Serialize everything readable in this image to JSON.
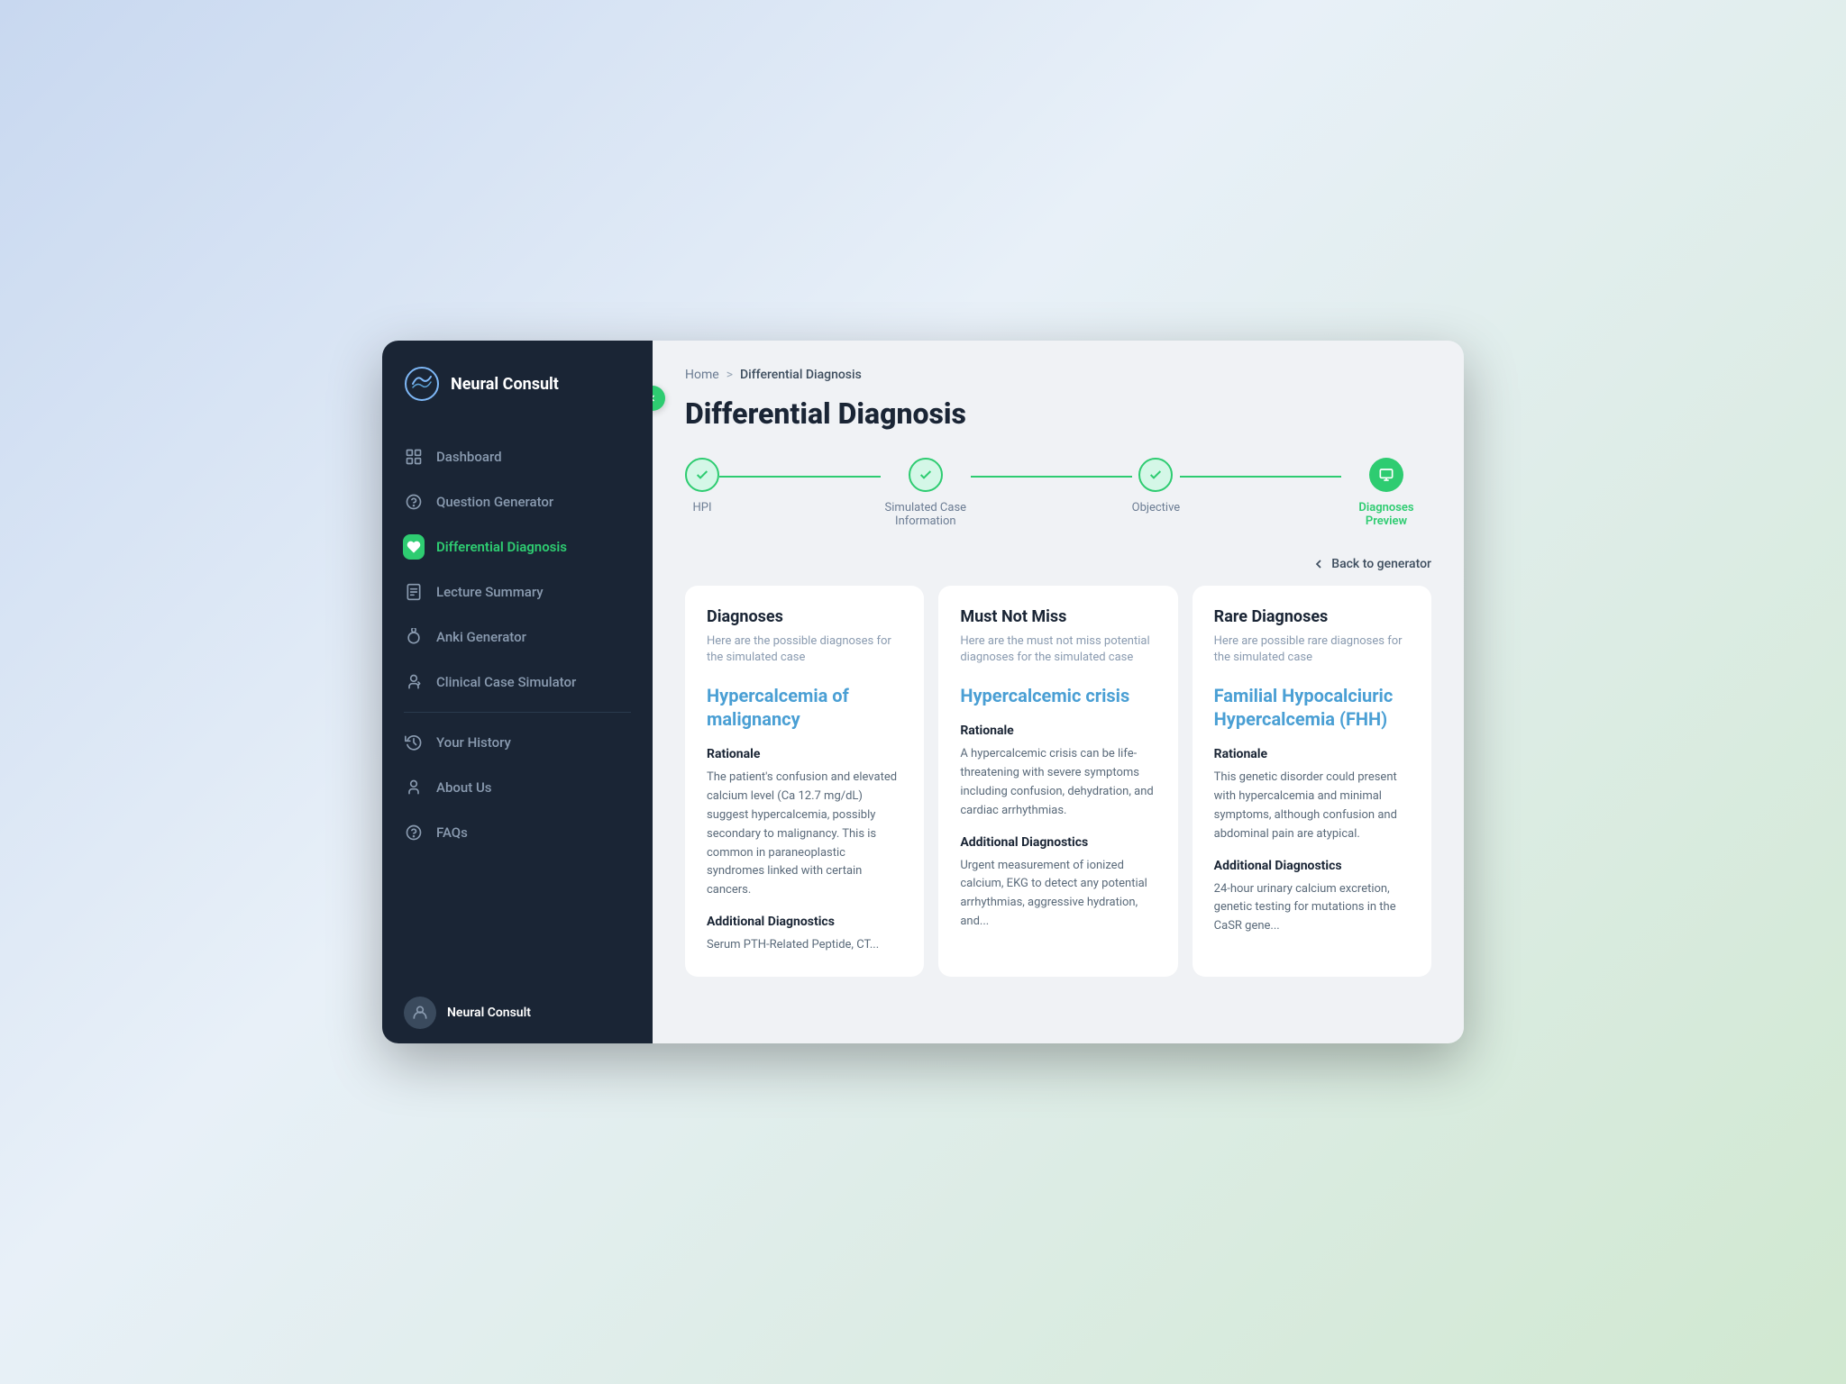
{
  "app": {
    "name": "Neural Consult",
    "logo_alt": "neural-consult-logo"
  },
  "sidebar": {
    "nav_items": [
      {
        "id": "dashboard",
        "label": "Dashboard",
        "icon": "home-icon",
        "active": false
      },
      {
        "id": "question-generator",
        "label": "Question Generator",
        "icon": "question-icon",
        "active": false
      },
      {
        "id": "differential-diagnosis",
        "label": "Differential Diagnosis",
        "icon": "heart-icon",
        "active": true
      },
      {
        "id": "lecture-summary",
        "label": "Lecture Summary",
        "icon": "document-icon",
        "active": false
      },
      {
        "id": "anki-generator",
        "label": "Anki Generator",
        "icon": "brain-icon",
        "active": false
      },
      {
        "id": "clinical-case-simulator",
        "label": "Clinical Case Simulator",
        "icon": "person-icon",
        "active": false
      }
    ],
    "bottom_items": [
      {
        "id": "your-history",
        "label": "Your History",
        "icon": "history-icon"
      },
      {
        "id": "about-us",
        "label": "About Us",
        "icon": "about-icon"
      },
      {
        "id": "faqs",
        "label": "FAQs",
        "icon": "faq-icon"
      }
    ],
    "user": {
      "name": "Neural Consult",
      "icon": "user-avatar"
    }
  },
  "breadcrumb": {
    "home": "Home",
    "separator": ">",
    "current": "Differential Diagnosis"
  },
  "page": {
    "title": "Differential Diagnosis",
    "back_link": "Back to generator"
  },
  "progress": {
    "steps": [
      {
        "id": "hpi",
        "label": "HPI",
        "state": "done"
      },
      {
        "id": "simulated-case",
        "label": "Simulated Case Information",
        "state": "done"
      },
      {
        "id": "objective",
        "label": "Objective",
        "state": "done"
      },
      {
        "id": "diagnoses-preview",
        "label": "Diagnoses Preview",
        "state": "active"
      }
    ]
  },
  "cards": [
    {
      "id": "diagnoses",
      "title": "Diagnoses",
      "subtitle": "Here are the possible diagnoses for the simulated case",
      "diagnosis_name": "Hypercalcemia of malignancy",
      "rationale_label": "Rationale",
      "rationale_text": "The patient's confusion and elevated calcium level (Ca 12.7 mg/dL) suggest hypercalcemia, possibly secondary to malignancy. This is common in paraneoplastic syndromes linked with certain cancers.",
      "additional_label": "Additional Diagnostics",
      "additional_text": "Serum PTH-Related Peptide, CT..."
    },
    {
      "id": "must-not-miss",
      "title": "Must Not Miss",
      "subtitle": "Here are the must not miss potential diagnoses for the simulated case",
      "diagnosis_name": "Hypercalcemic crisis",
      "rationale_label": "Rationale",
      "rationale_text": "A hypercalcemic crisis can be life-threatening with severe symptoms including confusion, dehydration, and cardiac arrhythmias.",
      "additional_label": "Additional Diagnostics",
      "additional_text": "Urgent measurement of ionized calcium, EKG to detect any potential arrhythmias, aggressive hydration, and..."
    },
    {
      "id": "rare-diagnoses",
      "title": "Rare Diagnoses",
      "subtitle": "Here are possible rare diagnoses for the simulated case",
      "diagnosis_name": "Familial Hypocalciuric Hypercalcemia (FHH)",
      "rationale_label": "Rationale",
      "rationale_text": "This genetic disorder could present with hypercalcemia and minimal symptoms, although confusion and abdominal pain are atypical.",
      "additional_label": "Additional Diagnostics",
      "additional_text": "24-hour urinary calcium excretion, genetic testing for mutations in the CaSR gene..."
    }
  ]
}
